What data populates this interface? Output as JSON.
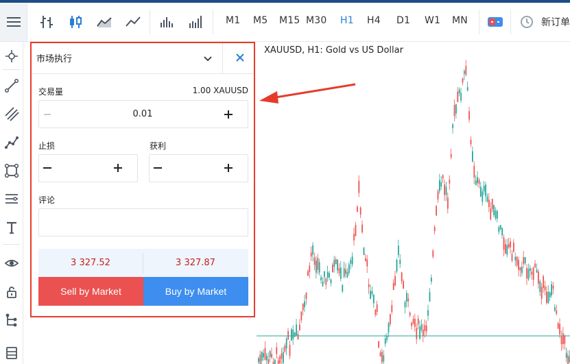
{
  "toolbar": {
    "timeframes": [
      {
        "label": "M1",
        "active": false
      },
      {
        "label": "M5",
        "active": false
      },
      {
        "label": "M15",
        "active": false
      },
      {
        "label": "M30",
        "active": false
      },
      {
        "label": "H1",
        "active": true
      },
      {
        "label": "H4",
        "active": false
      },
      {
        "label": "D1",
        "active": false
      },
      {
        "label": "W1",
        "active": false
      },
      {
        "label": "MN",
        "active": false
      }
    ],
    "new_order_label": "新订单",
    "icons": [
      "menu-icon",
      "bar-chart-icon",
      "candlestick-icon",
      "area-chart-icon",
      "line-chart-icon",
      "volume-icon",
      "tick-volume-icon",
      "trade-toggle-icon",
      "clock-icon"
    ]
  },
  "left_tools": [
    "crosshair-icon",
    "trendline-icon",
    "channel-icon",
    "polyline-icon",
    "shape-icon",
    "fibonacci-icon",
    "text-icon",
    "eye-icon",
    "lock-icon",
    "tree-icon",
    "objects-icon"
  ],
  "chart": {
    "title": "XAUUSD, H1: Gold vs US Dollar",
    "colors": {
      "bull": "#26a69a",
      "bear": "#ef5350",
      "price_line": "#26a69a"
    }
  },
  "order_panel": {
    "order_type": "市场执行",
    "volume_label": "交易量",
    "volume_unit": "1.00 XAUUSD",
    "volume_value": "0.01",
    "stop_loss_label": "止损",
    "take_profit_label": "获利",
    "stop_loss_value": "",
    "take_profit_value": "",
    "comment_label": "评论",
    "comment_value": "",
    "bid_price": "3 327.52",
    "ask_price": "3 327.87",
    "sell_label": "Sell by Market",
    "buy_label": "Buy by Market",
    "colors": {
      "sell": "#ea5150",
      "buy": "#3d8eee",
      "highlight": "#e53b2c",
      "price": "#c8201f"
    }
  }
}
